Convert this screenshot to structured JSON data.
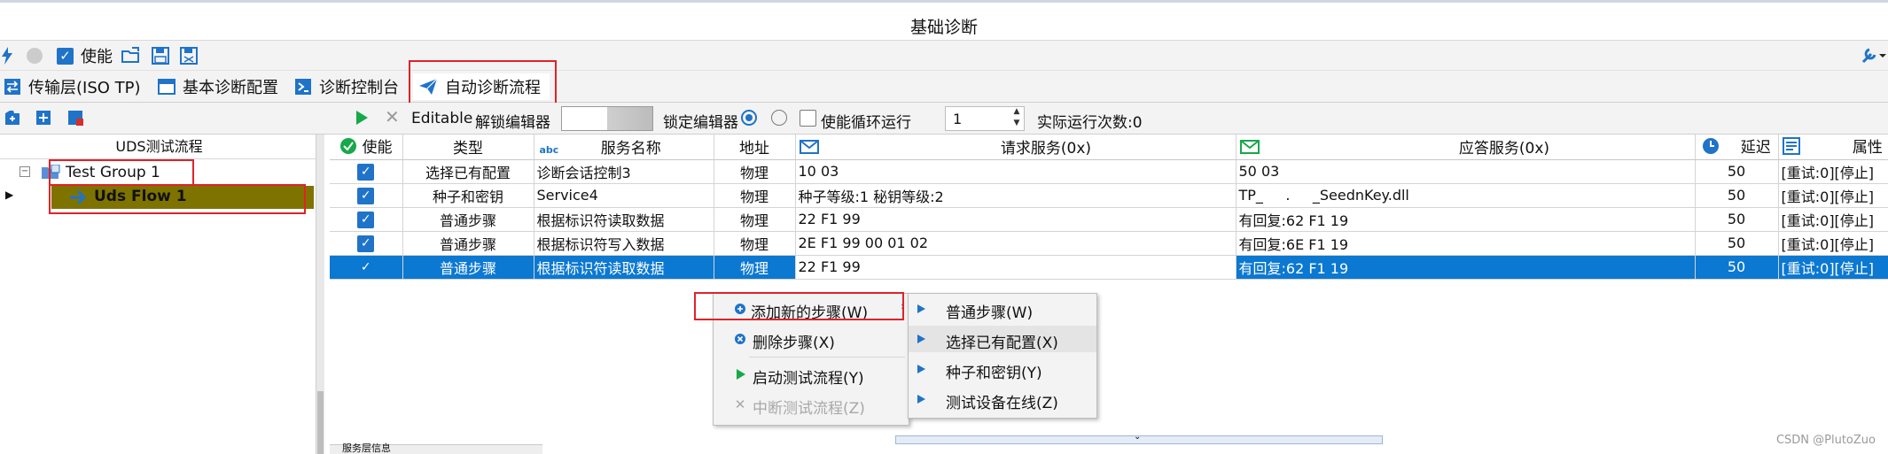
{
  "window": {
    "title": "基础诊断"
  },
  "toolbar1": {
    "enable_label": "使能"
  },
  "tabs": [
    {
      "label": "传输层(ISO TP)"
    },
    {
      "label": "基本诊断配置"
    },
    {
      "label": "诊断控制台"
    },
    {
      "label": "自动诊断流程"
    }
  ],
  "toolbar2": {
    "editable_label": "Editable",
    "unlock_label": "解锁编辑器",
    "lock_label": "锁定编辑器",
    "loop_label": "使能循环运行",
    "loop_count": "1",
    "run_count_label": "实际运行次数:0"
  },
  "tree": {
    "header": "UDS测试流程",
    "group": "Test Group 1",
    "flow": "Uds Flow 1"
  },
  "grid": {
    "columns": [
      "使能",
      "类型",
      "服务名称",
      "地址",
      "请求服务(0x)",
      "应答服务(0x)",
      "延迟",
      "属性"
    ],
    "rows": [
      {
        "type": "选择已有配置",
        "name": "诊断会话控制3",
        "addr": "物理",
        "req": "10 03",
        "resp": "50 03",
        "delay": "50",
        "attr": "[重试:0][停止]"
      },
      {
        "type": "种子和密钥",
        "name": "Service4",
        "addr": "物理",
        "req": "种子等级:1 秘钥等级:2",
        "resp": "TP_     .     _SeednKey.dll",
        "delay": "50",
        "attr": "[重试:0][停止]"
      },
      {
        "type": "普通步骤",
        "name": "根据标识符读取数据",
        "addr": "物理",
        "req": "22 F1 99",
        "resp": "有回复:62 F1 19",
        "delay": "50",
        "attr": "[重试:0][停止]"
      },
      {
        "type": "普通步骤",
        "name": "根据标识符写入数据",
        "addr": "物理",
        "req": "2E F1 99 00 01 02",
        "resp": "有回复:6E F1 19",
        "delay": "50",
        "attr": "[重试:0][停止]"
      },
      {
        "type": "普通步骤",
        "name": "根据标识符读取数据",
        "addr": "物理",
        "req": "22 F1 99",
        "resp": "有回复:62 F1 19",
        "delay": "50",
        "attr": "[重试:0][停止]"
      }
    ]
  },
  "context_menu": {
    "items": [
      "添加新的步骤(W)",
      "删除步骤(X)",
      "启动测试流程(Y)",
      "中断测试流程(Z)"
    ]
  },
  "submenu": {
    "items": [
      "普通步骤(W)",
      "选择已有配置(X)",
      "种子和密钥(Y)",
      "测试设备在线(Z)"
    ]
  },
  "bottom": {
    "tab_label": "服务层信息"
  },
  "watermark": "CSDN @PlutoZuo",
  "colors": {
    "accent": "#1f73c8",
    "selection": "#0b78d1",
    "highlight_box": "#e0222a",
    "flow_bg": "#7f7300"
  }
}
